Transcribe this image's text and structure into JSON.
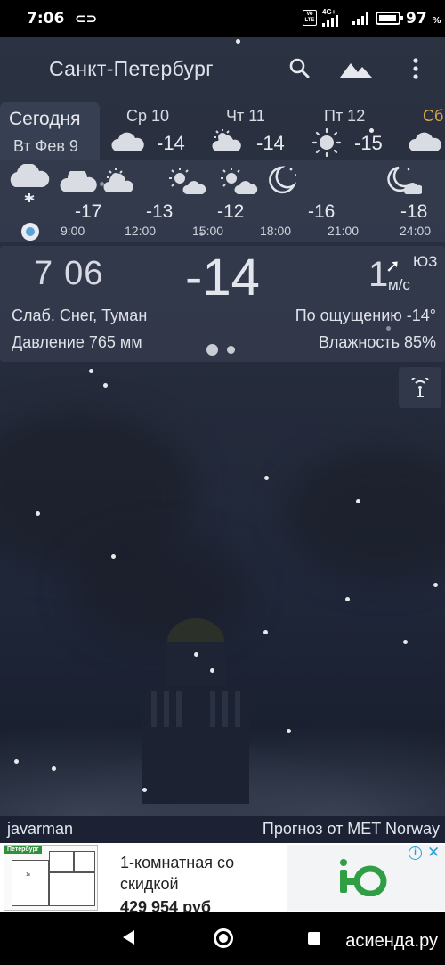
{
  "status_bar": {
    "time": "7:06",
    "link_icon": "link-icon",
    "volte": "Vo LTE",
    "network": "4G+",
    "battery_pct": "97",
    "battery_unit": "%"
  },
  "app_bar": {
    "city": "Санкт-Петербург",
    "icons": [
      "search-icon",
      "landscape-icon",
      "more-vert-icon"
    ]
  },
  "days": [
    {
      "label": "Сегодня",
      "sublabel": "Вт Фев 9",
      "selected": true
    },
    {
      "label": "Ср 10",
      "temp": "-14",
      "icon": "cloud-icon"
    },
    {
      "label": "Чт 11",
      "temp": "-14",
      "icon": "sun-cloud-icon"
    },
    {
      "label": "Пт 12",
      "temp": "-15",
      "icon": "sun-icon"
    },
    {
      "label": "Сб",
      "icon": "cloud-icon"
    }
  ],
  "hourly": [
    {
      "temp": "-17",
      "time": "9:00",
      "icon": "cloud-snow-icon"
    },
    {
      "temp": "-13",
      "time": "12:00",
      "icon": "cloud-icon"
    },
    {
      "temp": "-12",
      "time": "15:00",
      "icon": "sun-cloud-icon"
    },
    {
      "temp": "",
      "time": "18:00",
      "icon": "moon-icon"
    },
    {
      "temp": "-16",
      "time": "21:00",
      "icon": ""
    },
    {
      "temp": "-18",
      "time": "24:00",
      "icon": "moon-cloud-icon"
    }
  ],
  "current": {
    "clock_h": "7",
    "clock_m": "06",
    "temperature": "-14",
    "wind_speed": "1",
    "wind_dir": "ЮЗ",
    "wind_unit": "м/с",
    "condition": "Слаб. Снег, Туман",
    "pressure": "Давление 765 мм",
    "feels_like": "По ощущению -14°",
    "humidity": "Влажность 85%",
    "pager_pages": 2,
    "pager_active": 1
  },
  "credits": {
    "author": "javarman",
    "source": "Прогноз от MET Norway"
  },
  "ad": {
    "plan_tag": "Петербург",
    "headline": "1-комнатная со скидкой",
    "price": "429 954 руб",
    "logo_letter": "Ю",
    "info": "i",
    "close": "✕",
    "brand_color": "#2f9e44"
  },
  "watermark": "асиенда.ру",
  "colors": {
    "accent_saturday": "#d9a74a",
    "now_dot": "#5aa3d8",
    "panel": "#3c4458"
  }
}
